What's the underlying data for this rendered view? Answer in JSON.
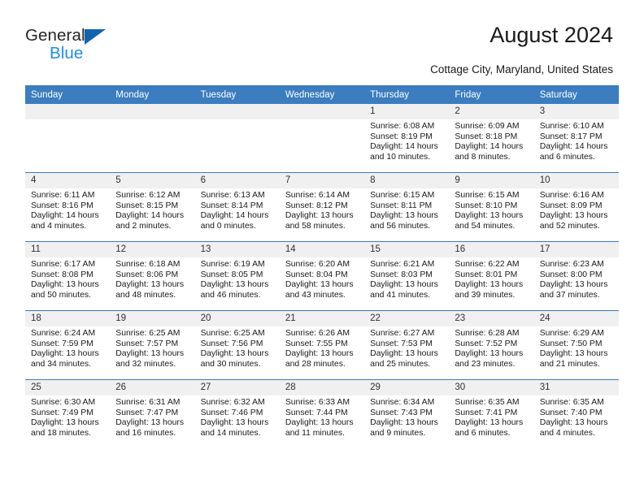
{
  "brand": {
    "name_top": "General",
    "name_bottom": "Blue",
    "triangle_color": "#1265ad",
    "blue_color": "#1f8fe0"
  },
  "header": {
    "title": "August 2024",
    "subtitle": "Cottage City, Maryland, United States",
    "header_bg": "#3b7dbf",
    "daycell_bg": "#f0f0f0"
  },
  "weekdays": [
    "Sunday",
    "Monday",
    "Tuesday",
    "Wednesday",
    "Thursday",
    "Friday",
    "Saturday"
  ],
  "labels": {
    "sunrise": "Sunrise:",
    "sunset": "Sunset:",
    "daylight": "Daylight:"
  },
  "weeks": [
    [
      {
        "blank": true
      },
      {
        "blank": true
      },
      {
        "blank": true
      },
      {
        "blank": true
      },
      {
        "day": "1",
        "sunrise": "Sunrise: 6:08 AM",
        "sunset": "Sunset: 8:19 PM",
        "daylight": "Daylight: 14 hours and 10 minutes."
      },
      {
        "day": "2",
        "sunrise": "Sunrise: 6:09 AM",
        "sunset": "Sunset: 8:18 PM",
        "daylight": "Daylight: 14 hours and 8 minutes."
      },
      {
        "day": "3",
        "sunrise": "Sunrise: 6:10 AM",
        "sunset": "Sunset: 8:17 PM",
        "daylight": "Daylight: 14 hours and 6 minutes."
      }
    ],
    [
      {
        "day": "4",
        "sunrise": "Sunrise: 6:11 AM",
        "sunset": "Sunset: 8:16 PM",
        "daylight": "Daylight: 14 hours and 4 minutes."
      },
      {
        "day": "5",
        "sunrise": "Sunrise: 6:12 AM",
        "sunset": "Sunset: 8:15 PM",
        "daylight": "Daylight: 14 hours and 2 minutes."
      },
      {
        "day": "6",
        "sunrise": "Sunrise: 6:13 AM",
        "sunset": "Sunset: 8:14 PM",
        "daylight": "Daylight: 14 hours and 0 minutes."
      },
      {
        "day": "7",
        "sunrise": "Sunrise: 6:14 AM",
        "sunset": "Sunset: 8:12 PM",
        "daylight": "Daylight: 13 hours and 58 minutes."
      },
      {
        "day": "8",
        "sunrise": "Sunrise: 6:15 AM",
        "sunset": "Sunset: 8:11 PM",
        "daylight": "Daylight: 13 hours and 56 minutes."
      },
      {
        "day": "9",
        "sunrise": "Sunrise: 6:15 AM",
        "sunset": "Sunset: 8:10 PM",
        "daylight": "Daylight: 13 hours and 54 minutes."
      },
      {
        "day": "10",
        "sunrise": "Sunrise: 6:16 AM",
        "sunset": "Sunset: 8:09 PM",
        "daylight": "Daylight: 13 hours and 52 minutes."
      }
    ],
    [
      {
        "day": "11",
        "sunrise": "Sunrise: 6:17 AM",
        "sunset": "Sunset: 8:08 PM",
        "daylight": "Daylight: 13 hours and 50 minutes."
      },
      {
        "day": "12",
        "sunrise": "Sunrise: 6:18 AM",
        "sunset": "Sunset: 8:06 PM",
        "daylight": "Daylight: 13 hours and 48 minutes."
      },
      {
        "day": "13",
        "sunrise": "Sunrise: 6:19 AM",
        "sunset": "Sunset: 8:05 PM",
        "daylight": "Daylight: 13 hours and 46 minutes."
      },
      {
        "day": "14",
        "sunrise": "Sunrise: 6:20 AM",
        "sunset": "Sunset: 8:04 PM",
        "daylight": "Daylight: 13 hours and 43 minutes."
      },
      {
        "day": "15",
        "sunrise": "Sunrise: 6:21 AM",
        "sunset": "Sunset: 8:03 PM",
        "daylight": "Daylight: 13 hours and 41 minutes."
      },
      {
        "day": "16",
        "sunrise": "Sunrise: 6:22 AM",
        "sunset": "Sunset: 8:01 PM",
        "daylight": "Daylight: 13 hours and 39 minutes."
      },
      {
        "day": "17",
        "sunrise": "Sunrise: 6:23 AM",
        "sunset": "Sunset: 8:00 PM",
        "daylight": "Daylight: 13 hours and 37 minutes."
      }
    ],
    [
      {
        "day": "18",
        "sunrise": "Sunrise: 6:24 AM",
        "sunset": "Sunset: 7:59 PM",
        "daylight": "Daylight: 13 hours and 34 minutes."
      },
      {
        "day": "19",
        "sunrise": "Sunrise: 6:25 AM",
        "sunset": "Sunset: 7:57 PM",
        "daylight": "Daylight: 13 hours and 32 minutes."
      },
      {
        "day": "20",
        "sunrise": "Sunrise: 6:25 AM",
        "sunset": "Sunset: 7:56 PM",
        "daylight": "Daylight: 13 hours and 30 minutes."
      },
      {
        "day": "21",
        "sunrise": "Sunrise: 6:26 AM",
        "sunset": "Sunset: 7:55 PM",
        "daylight": "Daylight: 13 hours and 28 minutes."
      },
      {
        "day": "22",
        "sunrise": "Sunrise: 6:27 AM",
        "sunset": "Sunset: 7:53 PM",
        "daylight": "Daylight: 13 hours and 25 minutes."
      },
      {
        "day": "23",
        "sunrise": "Sunrise: 6:28 AM",
        "sunset": "Sunset: 7:52 PM",
        "daylight": "Daylight: 13 hours and 23 minutes."
      },
      {
        "day": "24",
        "sunrise": "Sunrise: 6:29 AM",
        "sunset": "Sunset: 7:50 PM",
        "daylight": "Daylight: 13 hours and 21 minutes."
      }
    ],
    [
      {
        "day": "25",
        "sunrise": "Sunrise: 6:30 AM",
        "sunset": "Sunset: 7:49 PM",
        "daylight": "Daylight: 13 hours and 18 minutes."
      },
      {
        "day": "26",
        "sunrise": "Sunrise: 6:31 AM",
        "sunset": "Sunset: 7:47 PM",
        "daylight": "Daylight: 13 hours and 16 minutes."
      },
      {
        "day": "27",
        "sunrise": "Sunrise: 6:32 AM",
        "sunset": "Sunset: 7:46 PM",
        "daylight": "Daylight: 13 hours and 14 minutes."
      },
      {
        "day": "28",
        "sunrise": "Sunrise: 6:33 AM",
        "sunset": "Sunset: 7:44 PM",
        "daylight": "Daylight: 13 hours and 11 minutes."
      },
      {
        "day": "29",
        "sunrise": "Sunrise: 6:34 AM",
        "sunset": "Sunset: 7:43 PM",
        "daylight": "Daylight: 13 hours and 9 minutes."
      },
      {
        "day": "30",
        "sunrise": "Sunrise: 6:35 AM",
        "sunset": "Sunset: 7:41 PM",
        "daylight": "Daylight: 13 hours and 6 minutes."
      },
      {
        "day": "31",
        "sunrise": "Sunrise: 6:35 AM",
        "sunset": "Sunset: 7:40 PM",
        "daylight": "Daylight: 13 hours and 4 minutes."
      }
    ]
  ]
}
